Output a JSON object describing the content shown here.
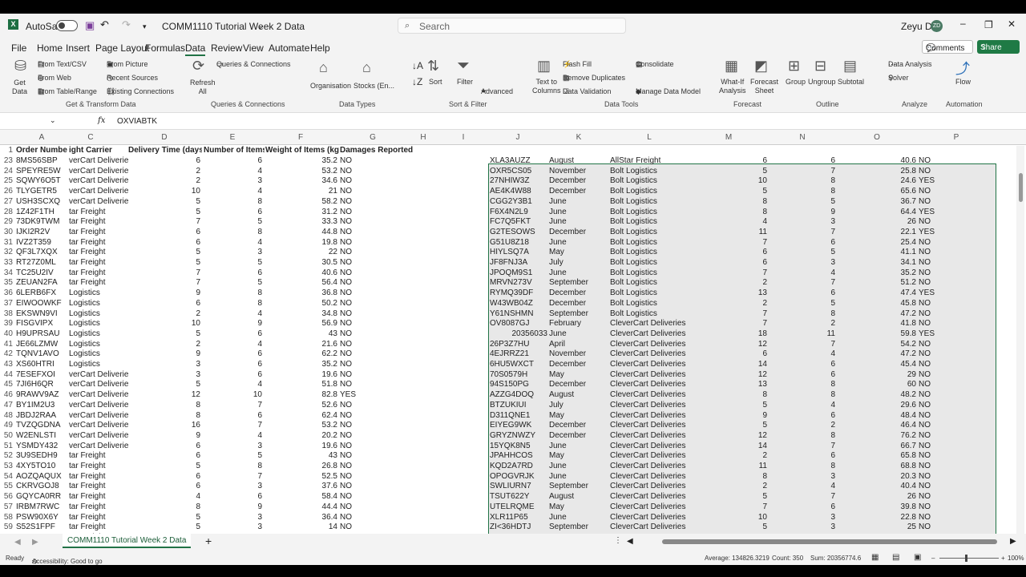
{
  "app": {
    "autosave_label": "AutoSave",
    "doc_title": "COMM1110 Tutorial Week 2 Data",
    "search_placeholder": "Search",
    "user_name": "Zeyu Du",
    "user_initials": "ZD"
  },
  "menu": [
    "File",
    "Home",
    "Insert",
    "Page Layout",
    "Formulas",
    "Data",
    "Review",
    "View",
    "Automate",
    "Help"
  ],
  "comments_label": "Comments",
  "share_label": "Share",
  "ribbon": {
    "get_data": "Get\nData",
    "from_text_csv": "From Text/CSV",
    "from_web": "From Web",
    "from_table_range": "From Table/Range",
    "from_picture": "From Picture",
    "recent_sources": "Recent Sources",
    "existing_connections": "Existing Connections",
    "refresh_all": "Refresh\nAll",
    "queries_connections": "Queries & Connections",
    "organisation": "Organisation",
    "stocks": "Stocks (En...",
    "sort": "Sort",
    "filter": "Filter",
    "advanced": "Advanced",
    "text_to_columns": "Text to\nColumns",
    "flash_fill": "Flash Fill",
    "remove_duplicates": "Remove Duplicates",
    "data_validation": "Data Validation",
    "consolidate": "Consolidate",
    "manage_data_model": "Manage Data Model",
    "what_if": "What-If\nAnalysis",
    "forecast_sheet": "Forecast\nSheet",
    "group": "Group",
    "ungroup": "Ungroup",
    "subtotal": "Subtotal",
    "data_analysis": "Data Analysis",
    "solver": "Solver",
    "flow": "Flow",
    "groups": [
      "Get & Transform Data",
      "Queries & Connections",
      "Data Types",
      "Sort & Filter",
      "Data Tools",
      "Forecast",
      "Outline",
      "Analyze",
      "Automation"
    ]
  },
  "formula_bar": {
    "fx": "fx",
    "value": "OXVIABTK"
  },
  "columns": [
    "A",
    "C",
    "D",
    "E",
    "F",
    "G",
    "H",
    "I",
    "J",
    "K",
    "L",
    "M",
    "N",
    "O",
    "P"
  ],
  "header_row": {
    "num": "1",
    "a": "Order Numbe",
    "c": "ight Carrier",
    "d": "Delivery Time (days",
    "e": "Number of Items",
    "f": "Weight of Items (kg",
    "g": "Damages Reported"
  },
  "left_rows": [
    [
      "23",
      "8MS56SBP",
      "verCart Deliveries",
      "6",
      "6",
      "35.2",
      "NO"
    ],
    [
      "24",
      "SPEYRE5W",
      "verCart Deliveries",
      "2",
      "4",
      "53.2",
      "NO"
    ],
    [
      "25",
      "SQWY6O5T",
      "verCart Deliveries",
      "2",
      "3",
      "34.6",
      "NO"
    ],
    [
      "26",
      "TLYGETR5",
      "verCart Deliveries",
      "10",
      "4",
      "21",
      "NO"
    ],
    [
      "27",
      "USH3SCXQ",
      "verCart Deliveries",
      "5",
      "8",
      "58.2",
      "NO"
    ],
    [
      "28",
      "1Z42F1TH",
      "tar Freight",
      "5",
      "6",
      "31.2",
      "NO"
    ],
    [
      "29",
      "73DK9TWM",
      "tar Freight",
      "7",
      "5",
      "33.3",
      "NO"
    ],
    [
      "30",
      "IJKI2R2V",
      "tar Freight",
      "6",
      "8",
      "44.8",
      "NO"
    ],
    [
      "31",
      "IVZ2T359",
      "tar Freight",
      "6",
      "4",
      "19.8",
      "NO"
    ],
    [
      "32",
      "QF3L7XQX",
      "tar Freight",
      "5",
      "3",
      "22",
      "NO"
    ],
    [
      "33",
      "RT27Z0ML",
      "tar Freight",
      "5",
      "5",
      "30.5",
      "NO"
    ],
    [
      "34",
      "TC25U2IV",
      "tar Freight",
      "7",
      "6",
      "40.6",
      "NO"
    ],
    [
      "35",
      "ZEUAN2FA",
      "tar Freight",
      "7",
      "5",
      "56.4",
      "NO"
    ],
    [
      "36",
      "6LERB6FX",
      "Logistics",
      "9",
      "8",
      "36.8",
      "NO"
    ],
    [
      "37",
      "EIWOOWKF",
      "Logistics",
      "6",
      "8",
      "50.2",
      "NO"
    ],
    [
      "38",
      "EKSWN9VI",
      "Logistics",
      "2",
      "4",
      "34.8",
      "NO"
    ],
    [
      "39",
      "FISGVIPX",
      "Logistics",
      "10",
      "9",
      "56.9",
      "NO"
    ],
    [
      "40",
      "H9UPRSAU",
      "Logistics",
      "5",
      "6",
      "43",
      "NO"
    ],
    [
      "41",
      "JE66LZMW",
      "Logistics",
      "2",
      "4",
      "21.6",
      "NO"
    ],
    [
      "42",
      "TQNV1AVO",
      "Logistics",
      "9",
      "6",
      "62.2",
      "NO"
    ],
    [
      "43",
      "XS60HTRI",
      "Logistics",
      "3",
      "6",
      "35.2",
      "NO"
    ],
    [
      "44",
      "7ESEFXOI",
      "verCart Deliveries",
      "3",
      "6",
      "19.6",
      "NO"
    ],
    [
      "45",
      "7JI6H6QR",
      "verCart Deliveries",
      "5",
      "4",
      "51.8",
      "NO"
    ],
    [
      "46",
      "9RAWV9AZ",
      "verCart Deliveries",
      "12",
      "10",
      "82.8",
      "YES"
    ],
    [
      "47",
      "BY1IM2U3",
      "verCart Deliveries",
      "8",
      "7",
      "52.6",
      "NO"
    ],
    [
      "48",
      "JBDJ2RAA",
      "verCart Deliveries",
      "8",
      "6",
      "62.4",
      "NO"
    ],
    [
      "49",
      "TVZQGDNA",
      "verCart Deliveries",
      "16",
      "7",
      "53.2",
      "NO"
    ],
    [
      "50",
      "W2ENLSTI",
      "verCart Deliveries",
      "9",
      "4",
      "20.2",
      "NO"
    ],
    [
      "51",
      "YSMDY432",
      "verCart Deliveries",
      "6",
      "3",
      "19.6",
      "NO"
    ],
    [
      "52",
      "3U9SEDH9",
      "tar Freight",
      "6",
      "5",
      "43",
      "NO"
    ],
    [
      "53",
      "4XY5TO10",
      "tar Freight",
      "5",
      "8",
      "26.8",
      "NO"
    ],
    [
      "54",
      "AOZQAQUX",
      "tar Freight",
      "6",
      "7",
      "52.5",
      "NO"
    ],
    [
      "55",
      "CKRVGOJ8",
      "tar Freight",
      "6",
      "3",
      "37.6",
      "NO"
    ],
    [
      "56",
      "GQYCA0RR",
      "tar Freight",
      "4",
      "6",
      "58.4",
      "NO"
    ],
    [
      "57",
      "IRBM7RWC",
      "tar Freight",
      "8",
      "9",
      "44.4",
      "NO"
    ],
    [
      "58",
      "PSW90X6Y",
      "tar Freight",
      "5",
      "3",
      "36.4",
      "NO"
    ],
    [
      "59",
      "S52S1FPF",
      "tar Freight",
      "5",
      "3",
      "14",
      "NO"
    ],
    [
      "60",
      "Z2V6FTUT",
      "tar Freight",
      "7",
      "7",
      "41.3",
      "NO"
    ]
  ],
  "right_rows": [
    [
      "XLA3AUZZ",
      "August",
      "AllStar Freight",
      "6",
      "6",
      "40.6",
      "NO"
    ],
    [
      "OXR5CS05",
      "November",
      "Bolt Logistics",
      "5",
      "7",
      "25.8",
      "NO"
    ],
    [
      "27NHIW3Z",
      "December",
      "Bolt Logistics",
      "10",
      "8",
      "24.6",
      "YES"
    ],
    [
      "AE4K4W88",
      "December",
      "Bolt Logistics",
      "5",
      "8",
      "65.6",
      "NO"
    ],
    [
      "CGG2Y3B1",
      "June",
      "Bolt Logistics",
      "8",
      "5",
      "36.7",
      "NO"
    ],
    [
      "F6X4N2L9",
      "June",
      "Bolt Logistics",
      "8",
      "9",
      "64.4",
      "YES"
    ],
    [
      "FC7Q5FKT",
      "June",
      "Bolt Logistics",
      "4",
      "3",
      "26",
      "NO"
    ],
    [
      "G2TESOWS",
      "December",
      "Bolt Logistics",
      "11",
      "7",
      "22.1",
      "YES"
    ],
    [
      "G51U8Z18",
      "June",
      "Bolt Logistics",
      "7",
      "6",
      "25.4",
      "NO"
    ],
    [
      "HIYLSQ7A",
      "May",
      "Bolt Logistics",
      "6",
      "5",
      "41.1",
      "NO"
    ],
    [
      "JF8FNJ3A",
      "July",
      "Bolt Logistics",
      "6",
      "3",
      "34.1",
      "NO"
    ],
    [
      "JPOQM9S1",
      "June",
      "Bolt Logistics",
      "7",
      "4",
      "35.2",
      "NO"
    ],
    [
      "MRVN273V",
      "September",
      "Bolt Logistics",
      "2",
      "7",
      "51.2",
      "NO"
    ],
    [
      "RYMQ39DF",
      "December",
      "Bolt Logistics",
      "13",
      "6",
      "47.4",
      "YES"
    ],
    [
      "W43WB04Z",
      "December",
      "Bolt Logistics",
      "2",
      "5",
      "45.8",
      "NO"
    ],
    [
      "Y61NSHMN",
      "September",
      "Bolt Logistics",
      "7",
      "8",
      "47.2",
      "NO"
    ],
    [
      "OV8087GJ",
      "February",
      "CleverCart Deliveries",
      "7",
      "2",
      "41.8",
      "NO"
    ],
    [
      "20356033",
      "June",
      "CleverCart Deliveries",
      "18",
      "11",
      "59.8",
      "YES"
    ],
    [
      "26P3Z7HU",
      "April",
      "CleverCart Deliveries",
      "12",
      "7",
      "54.2",
      "NO"
    ],
    [
      "4EJRRZ21",
      "November",
      "CleverCart Deliveries",
      "6",
      "4",
      "47.2",
      "NO"
    ],
    [
      "6HU5WXCT",
      "December",
      "CleverCart Deliveries",
      "14",
      "6",
      "45.4",
      "NO"
    ],
    [
      "70S0579H",
      "May",
      "CleverCart Deliveries",
      "12",
      "6",
      "29",
      "NO"
    ],
    [
      "94S150PG",
      "December",
      "CleverCart Deliveries",
      "13",
      "8",
      "60",
      "NO"
    ],
    [
      "AZZG4DOQ",
      "August",
      "CleverCart Deliveries",
      "8",
      "8",
      "48.2",
      "NO"
    ],
    [
      "BTZUKIUI",
      "July",
      "CleverCart Deliveries",
      "5",
      "4",
      "29.6",
      "NO"
    ],
    [
      "D311QNE1",
      "May",
      "CleverCart Deliveries",
      "9",
      "6",
      "48.4",
      "NO"
    ],
    [
      "EIYEG9WK",
      "December",
      "CleverCart Deliveries",
      "5",
      "2",
      "46.4",
      "NO"
    ],
    [
      "GRYZNWZY",
      "December",
      "CleverCart Deliveries",
      "12",
      "8",
      "76.2",
      "NO"
    ],
    [
      "15YQK8N5",
      "June",
      "CleverCart Deliveries",
      "14",
      "7",
      "66.7",
      "NO"
    ],
    [
      "JPAHHCOS",
      "May",
      "CleverCart Deliveries",
      "2",
      "6",
      "65.8",
      "NO"
    ],
    [
      "KQD2A7RD",
      "June",
      "CleverCart Deliveries",
      "11",
      "8",
      "68.8",
      "NO"
    ],
    [
      "OPOGVRJK",
      "June",
      "CleverCart Deliveries",
      "8",
      "3",
      "20.3",
      "NO"
    ],
    [
      "SWLIURN7",
      "September",
      "CleverCart Deliveries",
      "2",
      "4",
      "40.4",
      "NO"
    ],
    [
      "TSUT622Y",
      "August",
      "CleverCart Deliveries",
      "5",
      "7",
      "26",
      "NO"
    ],
    [
      "UTELRQME",
      "May",
      "CleverCart Deliveries",
      "7",
      "6",
      "39.8",
      "NO"
    ],
    [
      "XLR11P65",
      "June",
      "CleverCart Deliveries",
      "10",
      "3",
      "22.8",
      "NO"
    ],
    [
      "ZI<36HDTJ",
      "September",
      "CleverCart Deliveries",
      "5",
      "3",
      "25",
      "NO"
    ]
  ],
  "sheet_tab": "COMM1110 Tutorial Week 2 Data",
  "status": {
    "ready": "Ready",
    "accessibility": "Accessibility: Good to go",
    "average": "Average: 134826.3219",
    "count": "Count: 350",
    "sum": "Sum: 20356774.6",
    "zoom": "100%"
  }
}
